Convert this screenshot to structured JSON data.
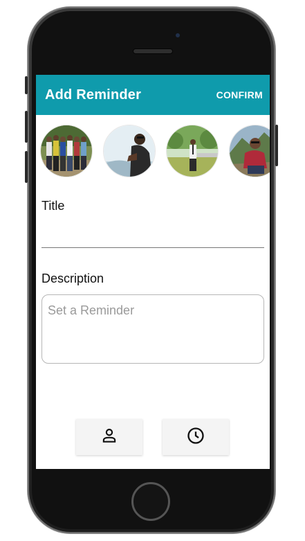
{
  "appbar": {
    "title": "Add Reminder",
    "confirm_label": "CONFIRM",
    "color": "#0f9bac"
  },
  "avatars": [
    {
      "name": "group-photo"
    },
    {
      "name": "person-hill"
    },
    {
      "name": "person-park"
    },
    {
      "name": "person-mountain"
    }
  ],
  "form": {
    "title_label": "Title",
    "title_value": "",
    "description_label": "Description",
    "description_placeholder": "Set a Reminder"
  },
  "actions": [
    {
      "icon": "person-icon"
    },
    {
      "icon": "clock-icon"
    }
  ]
}
